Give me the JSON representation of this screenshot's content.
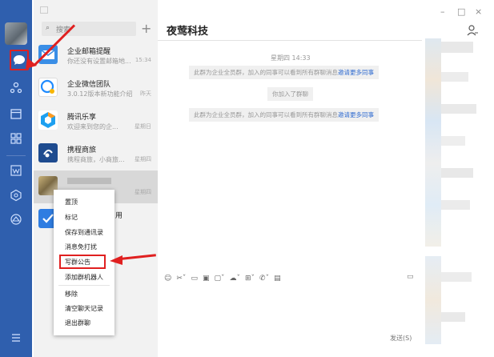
{
  "search": {
    "placeholder": "搜索"
  },
  "chat": {
    "title": "夜莺科技",
    "timestamp": "星期四 14:33",
    "system_msg_1": "此群为企业全员群，加入的同事可以看到所有群聊消息",
    "invite_link": "邀请更多同事",
    "joined_msg": "你加入了群聊",
    "system_msg_2": "此群为企业全员群，加入的同事可以看到所有群聊消息",
    "send_label": "发送(S)"
  },
  "conversations": [
    {
      "name": "企业邮箱提醒",
      "preview": "你还没有设置邮箱地...",
      "time": "15:34"
    },
    {
      "name": "企业微信团队",
      "preview": "3.0.12版本新功能介绍",
      "time": "昨天"
    },
    {
      "name": "腾讯乐享",
      "preview": "欢迎来到您的企...",
      "time": "星期日"
    },
    {
      "name": "携程商旅",
      "preview": "携程商旅，小商旅...",
      "time": "星期四"
    },
    {
      "name": "",
      "preview": "",
      "time": "星期四"
    },
    {
      "name": "用",
      "preview": "",
      "time": ""
    }
  ],
  "context_menu": {
    "items": [
      "置顶",
      "标记",
      "保存到通讯录",
      "消息免打扰",
      "写群公告",
      "添加群机器人",
      "移除",
      "清空聊天记录",
      "退出群聊"
    ]
  },
  "window": {
    "minimize": "–",
    "maximize": "□",
    "close": "×"
  },
  "colors": {
    "rail": "#2f5fae",
    "accent_link": "#2f6bd0",
    "annotation": "#e02020"
  },
  "icons": [
    "chat-icon",
    "contacts-icon",
    "calendar-icon",
    "apps-icon",
    "document-icon",
    "cube-icon",
    "drive-icon",
    "menu-icon",
    "add-icon",
    "person-icon"
  ]
}
